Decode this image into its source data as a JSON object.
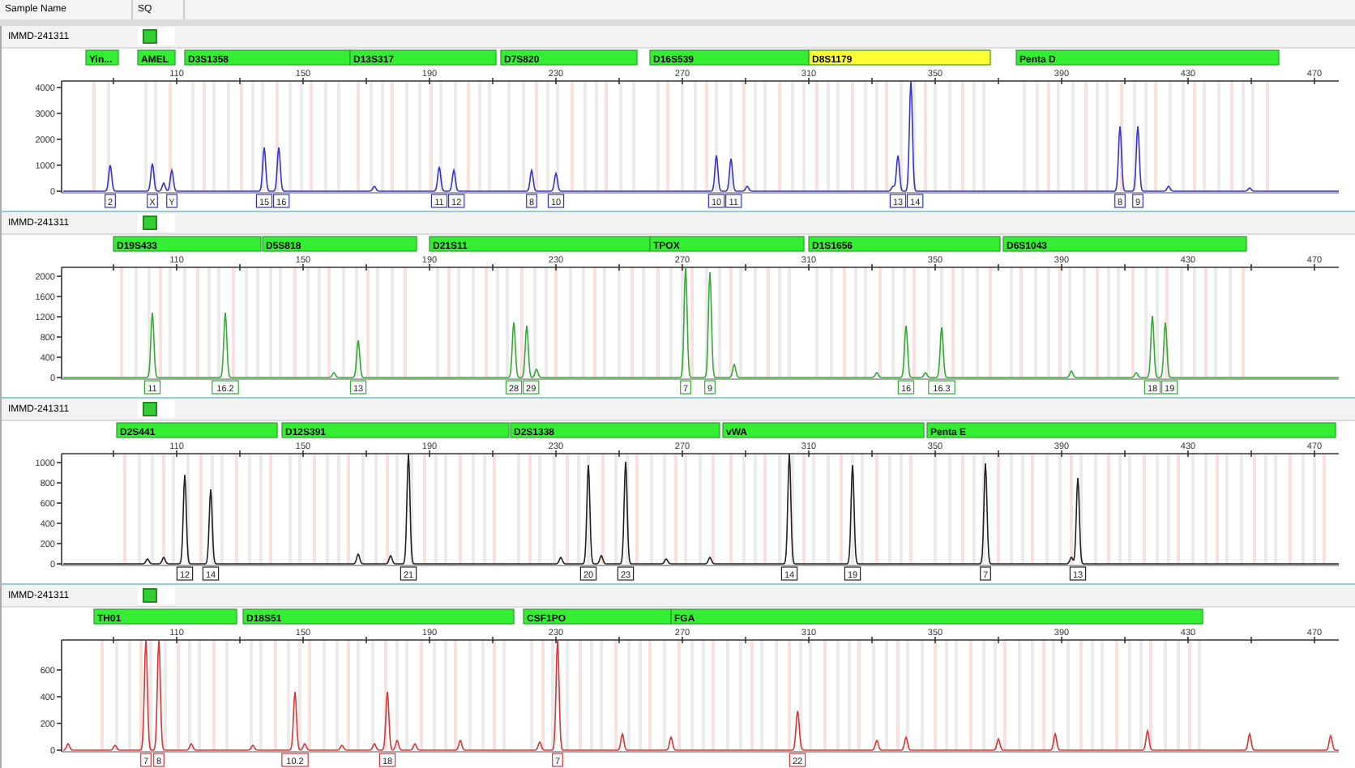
{
  "header": {
    "columns": [
      "Sample Name",
      "SQ"
    ]
  },
  "panels": [
    {
      "sample_name": "IMMD-241311",
      "color": "#3333cc",
      "y_ticks": [
        "4000",
        "3000",
        "2000",
        "1000",
        "0"
      ],
      "x_ticks": [
        "110",
        "150",
        "190",
        "230",
        "270",
        "310",
        "350",
        "390",
        "430",
        "470"
      ],
      "markers": [
        {
          "name": "Yin...",
          "color": "#33ee33"
        },
        {
          "name": "AMEL",
          "color": "#33ee33"
        },
        {
          "name": "D3S1358",
          "color": "#33ee33"
        },
        {
          "name": "D13S317",
          "color": "#33ee33"
        },
        {
          "name": "D7S820",
          "color": "#33ee33"
        },
        {
          "name": "D16S539",
          "color": "#33ee33"
        },
        {
          "name": "D8S1179",
          "color": "#ffff33"
        },
        {
          "name": "Penta D",
          "color": "#33ee33"
        }
      ],
      "alleles": [
        "2",
        "X",
        "Y",
        "15",
        "16",
        "11",
        "12",
        "8",
        "10",
        "10",
        "11",
        "13",
        "14",
        "8",
        "9"
      ]
    },
    {
      "sample_name": "IMMD-241311",
      "color": "#33aa33",
      "y_ticks": [
        "2000",
        "1600",
        "1200",
        "800",
        "400",
        "0"
      ],
      "x_ticks": [
        "110",
        "150",
        "190",
        "230",
        "270",
        "310",
        "350",
        "390",
        "430",
        "470"
      ],
      "markers": [
        {
          "name": "D19S433",
          "color": "#33ee33"
        },
        {
          "name": "D5S818",
          "color": "#33ee33"
        },
        {
          "name": "D21S11",
          "color": "#33ee33"
        },
        {
          "name": "TPOX",
          "color": "#33ee33"
        },
        {
          "name": "D1S1656",
          "color": "#33ee33"
        },
        {
          "name": "D6S1043",
          "color": "#33ee33"
        }
      ],
      "alleles": [
        "11",
        "16.2",
        "13",
        "28",
        "29",
        "7",
        "9",
        "16",
        "16.3",
        "18",
        "19"
      ]
    },
    {
      "sample_name": "IMMD-241311",
      "color": "#222222",
      "y_ticks": [
        "1000",
        "800",
        "600",
        "400",
        "200",
        "0"
      ],
      "x_ticks": [
        "110",
        "150",
        "190",
        "230",
        "270",
        "310",
        "350",
        "390",
        "430",
        "470"
      ],
      "markers": [
        {
          "name": "D2S441",
          "color": "#33ee33"
        },
        {
          "name": "D12S391",
          "color": "#33ee33"
        },
        {
          "name": "D2S1338",
          "color": "#33ee33"
        },
        {
          "name": "vWA",
          "color": "#33ee33"
        },
        {
          "name": "Penta E",
          "color": "#33ee33"
        }
      ],
      "alleles": [
        "12",
        "14",
        "21",
        "20",
        "23",
        "14",
        "19",
        "7",
        "13"
      ]
    },
    {
      "sample_name": "IMMD-241311",
      "color": "#dd3333",
      "y_ticks": [
        "600",
        "400",
        "200",
        "0"
      ],
      "x_ticks": [
        "110",
        "150",
        "190",
        "230",
        "270",
        "310",
        "350",
        "390",
        "430",
        "470"
      ],
      "markers": [
        {
          "name": "TH01",
          "color": "#33ee33"
        },
        {
          "name": "D18S51",
          "color": "#33ee33"
        },
        {
          "name": "CSF1PO",
          "color": "#33ee33"
        },
        {
          "name": "FGA",
          "color": "#33ee33"
        }
      ],
      "alleles": [
        "7",
        "8",
        "10.2",
        "18",
        "7",
        "22"
      ]
    }
  ]
}
